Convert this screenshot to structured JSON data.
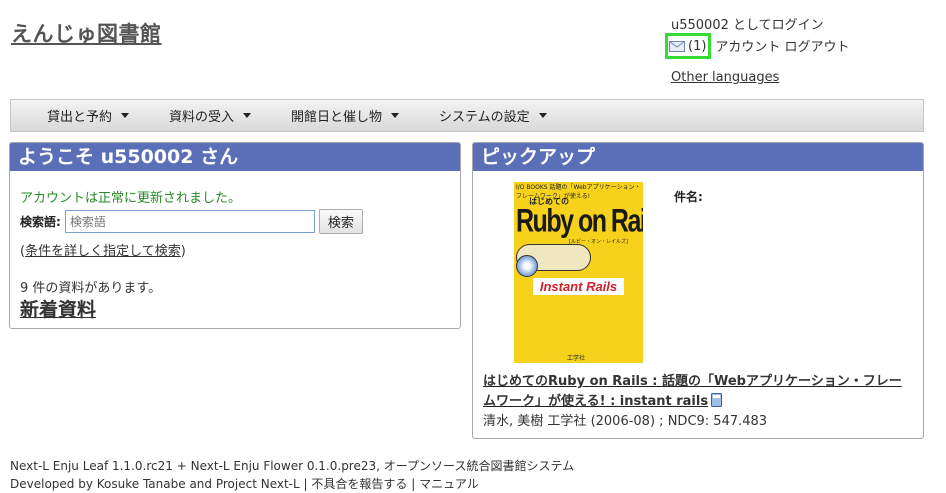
{
  "site": {
    "title": "えんじゅ図書館"
  },
  "header": {
    "login_status": "u550002 としてログイン",
    "mail_count": "(1)",
    "account_link": "アカウント",
    "logout_link": "ログアウト",
    "other_languages": "Other languages",
    "mail_icon": "mail-icon",
    "highlight_color": "#33dd33"
  },
  "nav": {
    "items": [
      {
        "label": "貸出と予約"
      },
      {
        "label": "資料の受入"
      },
      {
        "label": "開館日と催し物"
      },
      {
        "label": "システムの設定"
      }
    ]
  },
  "welcome": {
    "title": "ようこそ u550002 さん",
    "notice": "アカウントは正常に更新されました。",
    "search_label": "検索語:",
    "search_placeholder": "検索語",
    "search_button": "検索",
    "adv_open": "(",
    "adv_link": "条件を詳しく指定して検索",
    "adv_close": ")",
    "count_text": "9 件の資料があります。",
    "new_items": "新着資料"
  },
  "pickup": {
    "title": "ピックアップ",
    "item_label": "件名:",
    "cover": {
      "top_text": "I/O BOOKS 話題の「Webアプリケーション・フレームワーク」が使える!",
      "small_title": "はじめての",
      "main_title": "Ruby on Rails",
      "sub_title": "[ルビー・オン・レイルズ]",
      "instant": "Instant Rails",
      "publisher": "工学社"
    },
    "book_title": "はじめてのRuby on Rails : 話題の「Webアプリケーション・フレームワーク」が使える! : instant rails",
    "author": "清水, 美樹",
    "publisher": "工学社",
    "date": "(2006-08)",
    "separator": ";",
    "ndc": "NDC9: 547.483",
    "header_color": "#5b6fb8"
  },
  "footer": {
    "leaf": "Next-L Enju Leaf 1.1.0.rc21",
    "plus": "+",
    "flower": "Next-L Enju Flower 0.1.0.pre23",
    "suffix": ", オープンソース統合図書館システム",
    "developed_by": "Developed by",
    "author": "Kosuke Tanabe",
    "and": "and",
    "project": "Project Next-L",
    "bar1": "|",
    "report": "不具合を報告する",
    "bar2": "|",
    "manual": "マニュアル"
  }
}
